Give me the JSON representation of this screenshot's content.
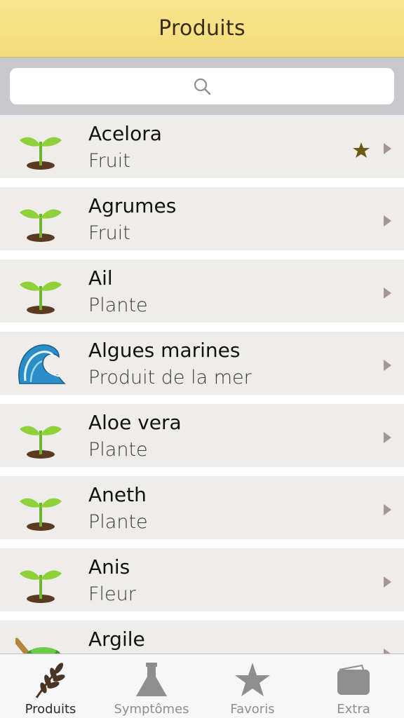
{
  "header": {
    "title": "Produits"
  },
  "search": {
    "placeholder": ""
  },
  "list": {
    "items": [
      {
        "title": "Acelora",
        "subtitle": "Fruit",
        "icon": "sprout-icon",
        "favorite": true
      },
      {
        "title": "Agrumes",
        "subtitle": "Fruit",
        "icon": "sprout-icon",
        "favorite": false
      },
      {
        "title": "Ail",
        "subtitle": "Plante",
        "icon": "sprout-icon",
        "favorite": false
      },
      {
        "title": "Algues marines",
        "subtitle": "Produit de la mer",
        "icon": "wave-icon",
        "favorite": false
      },
      {
        "title": "Aloe vera",
        "subtitle": "Plante",
        "icon": "sprout-icon",
        "favorite": false
      },
      {
        "title": "Aneth",
        "subtitle": "Plante",
        "icon": "sprout-icon",
        "favorite": false
      },
      {
        "title": "Anis",
        "subtitle": "Fleur",
        "icon": "sprout-icon",
        "favorite": false
      },
      {
        "title": "Argile",
        "subtitle": "",
        "icon": "clay-icon",
        "favorite": false
      }
    ]
  },
  "tabbar": {
    "tabs": [
      {
        "label": "Produits",
        "icon": "wheat-icon",
        "active": true
      },
      {
        "label": "Symptômes",
        "icon": "flask-icon",
        "active": false
      },
      {
        "label": "Favoris",
        "icon": "star-icon",
        "active": false
      },
      {
        "label": "Extra",
        "icon": "folder-icon",
        "active": false
      }
    ]
  },
  "colors": {
    "header_bg": "#f5df80",
    "row_bg": "#efedea",
    "favorite_star": "#6b5a16",
    "chevron": "#a59691",
    "tab_inactive": "#8e8e8e",
    "tab_active": "#2b2b2b"
  }
}
